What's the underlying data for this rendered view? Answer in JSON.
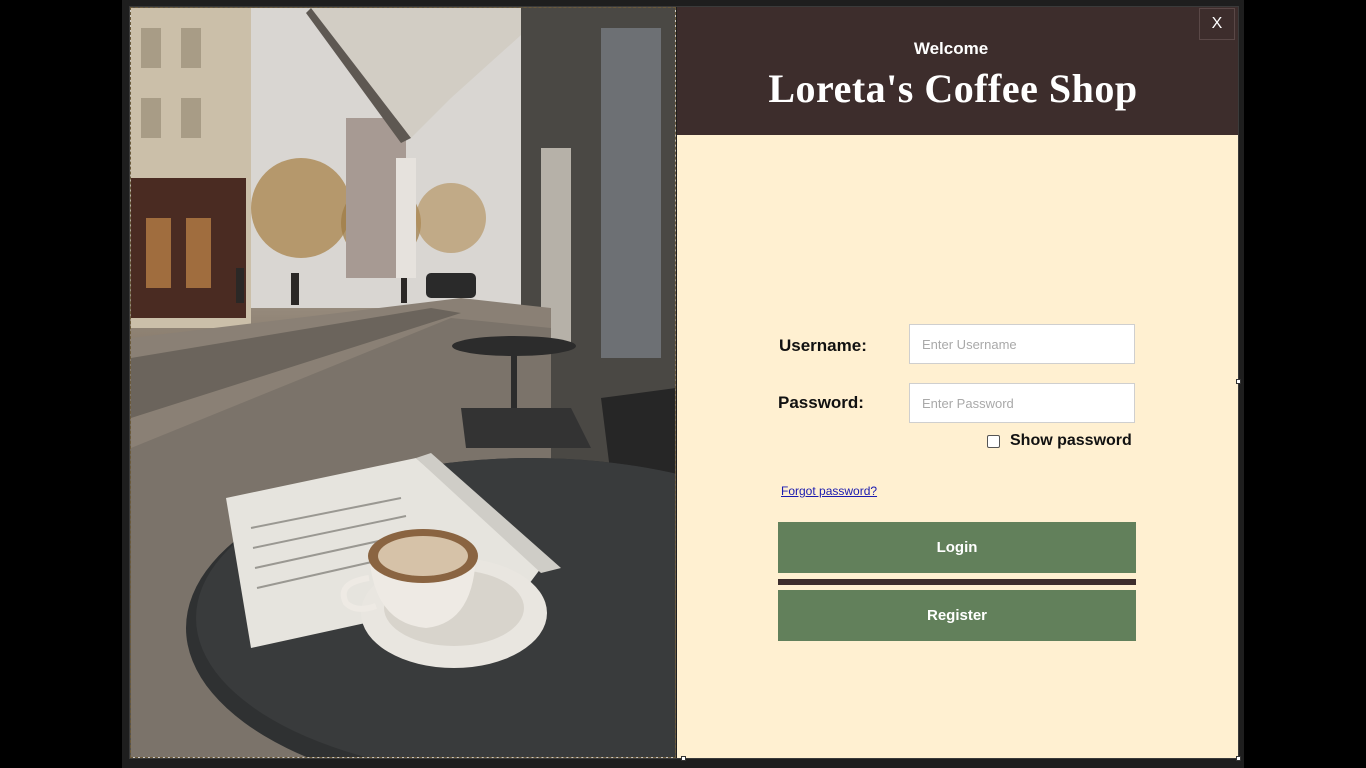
{
  "header": {
    "welcome": "Welcome",
    "title": "Loreta's Coffee Shop",
    "close_label": "X"
  },
  "form": {
    "username_label": "Username:",
    "username_placeholder": "Enter Username",
    "password_label": "Password:",
    "password_placeholder": "Enter Password",
    "show_password_label": "Show password",
    "show_password_checked": false,
    "forgot_password": "Forgot password?",
    "login_label": "Login",
    "register_label": "Register"
  },
  "colors": {
    "header_bg": "#3d2d2c",
    "panel_bg": "#fff0d1",
    "button_bg": "#62805b",
    "link": "#1a1ab0"
  },
  "images": {
    "background_photo": "cafe-table-coffee-newspaper-photo"
  }
}
